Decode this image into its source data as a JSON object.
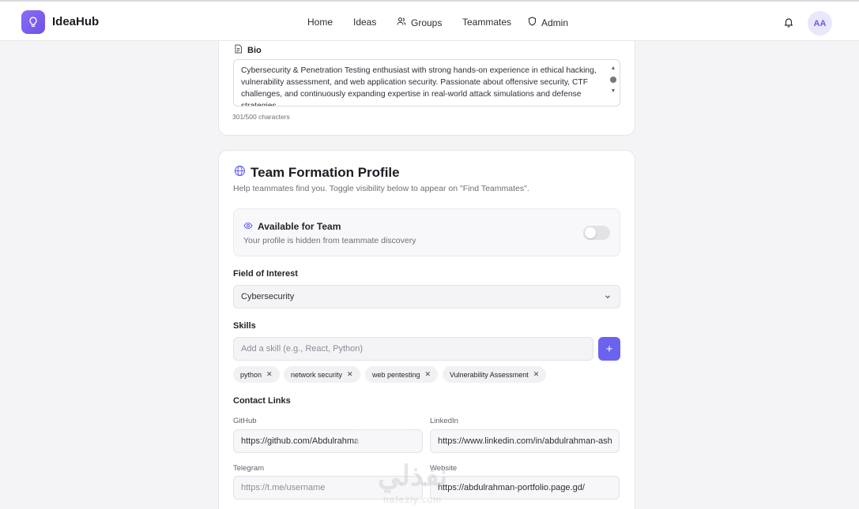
{
  "app": {
    "name": "IdeaHub"
  },
  "nav": {
    "links": [
      {
        "label": "Home",
        "icon": ""
      },
      {
        "label": "Ideas",
        "icon": ""
      },
      {
        "label": "Groups",
        "icon": "users-icon"
      },
      {
        "label": "Teammates",
        "icon": ""
      },
      {
        "label": "Admin",
        "icon": "shield-icon"
      }
    ],
    "avatar_initials": "AA"
  },
  "bio": {
    "label": "Bio",
    "text": "Cybersecurity & Penetration Testing enthusiast with strong hands-on experience in ethical hacking, vulnerability assessment, and web application security. Passionate about offensive security, CTF challenges, and continuously expanding expertise in real-world attack simulations and defense strategies.",
    "count": "301/500 characters"
  },
  "team_profile": {
    "title": "Team Formation Profile",
    "subtitle": "Help teammates find you. Toggle visibility below to appear on \"Find Teammates\".",
    "availability": {
      "title": "Available for Team",
      "subtitle": "Your profile is hidden from teammate discovery",
      "enabled": false
    },
    "field_label": "Field of Interest",
    "field_value": "Cybersecurity",
    "skills_label": "Skills",
    "skills_placeholder": "Add a skill (e.g., React, Python)",
    "skills": [
      "python",
      "network security",
      "web pentesting",
      "Vulnerability Assessment"
    ],
    "contact_label": "Contact Links",
    "github_label": "GitHub",
    "github_value": "https://github.com/Abdulrahma",
    "linkedin_label": "LinkedIn",
    "linkedin_value": "https://www.linkedin.com/in/abdulrahman-ashra",
    "telegram_label": "Telegram",
    "telegram_placeholder": "https://t.me/username",
    "website_label": "Website",
    "website_value": "https://abdulrahman-portfolio.page.gd/"
  },
  "watermark": {
    "text": "نفذلي",
    "sub": "nafezly.com"
  },
  "colors": {
    "accent": "#6b63f0",
    "brand_gradient_start": "#8b6cf6",
    "brand_gradient_end": "#6d52e8"
  }
}
